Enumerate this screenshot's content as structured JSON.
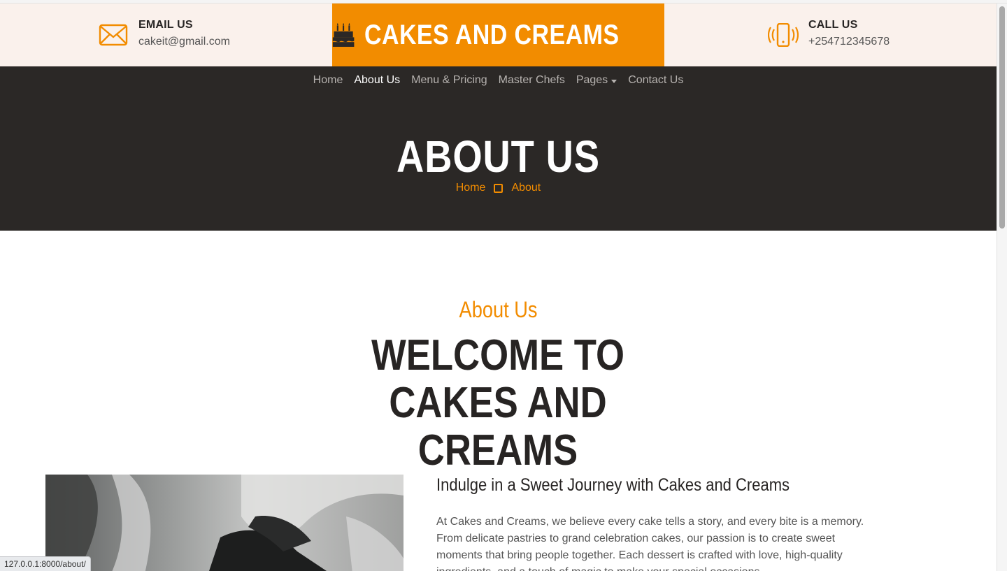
{
  "topbar": {
    "email": {
      "title": "EMAIL US",
      "value": "cakeit@gmail.com",
      "icon": "envelope-icon"
    },
    "brand": {
      "name": "CAKES AND CREAMS",
      "icon": "birthday-cake-icon"
    },
    "call": {
      "title": "CALL US",
      "value": "+254712345678",
      "icon": "phone-vibrate-icon"
    }
  },
  "nav": {
    "items": [
      {
        "label": "Home"
      },
      {
        "label": "About Us",
        "active": true
      },
      {
        "label": "Menu & Pricing"
      },
      {
        "label": "Master Chefs"
      },
      {
        "label": "Pages",
        "dropdown": true
      },
      {
        "label": "Contact Us"
      }
    ]
  },
  "hero": {
    "title": "ABOUT US",
    "breadcrumb": [
      "Home",
      "About"
    ]
  },
  "about": {
    "label": "About Us",
    "title": "WELCOME TO CAKES AND CREAMS",
    "heading": "Indulge in a Sweet Journey with Cakes and Creams",
    "body": "At Cakes and Creams, we believe every cake tells a story, and every bite is a memory. From delicate pastries to grand celebration cakes, our passion is to create sweet moments that bring people together. Each dessert is crafted with love, high-quality ingredients, and a touch of magic to make your special occasions"
  },
  "status_bar": {
    "url": "127.0.0.1:8000/about/"
  },
  "colors": {
    "accent": "#f28c00",
    "dark": "#2b2826",
    "cream": "#faf1ec",
    "text": "#272423"
  }
}
